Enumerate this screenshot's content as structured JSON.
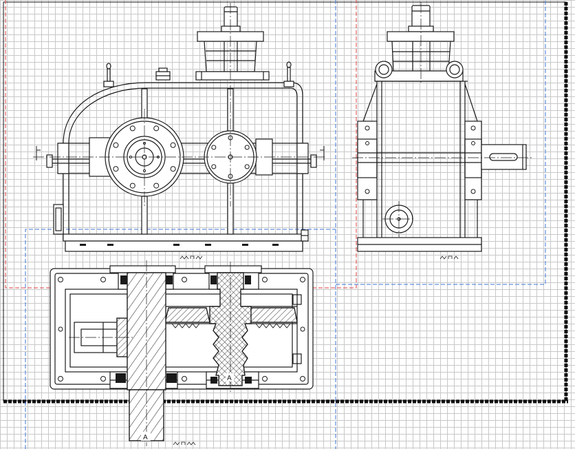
{
  "canvas": {
    "background": "#ffffff",
    "grid_color": "#c8c8c8"
  },
  "colors": {
    "drawing_line": "#1a1a1a",
    "red_viewport": "#e04040",
    "blue_viewport": "#3f74d9",
    "sheet_frame": "#111111"
  },
  "section_labels": {
    "input_shaft_mark": "A",
    "gear_shaft_mark": "A"
  }
}
